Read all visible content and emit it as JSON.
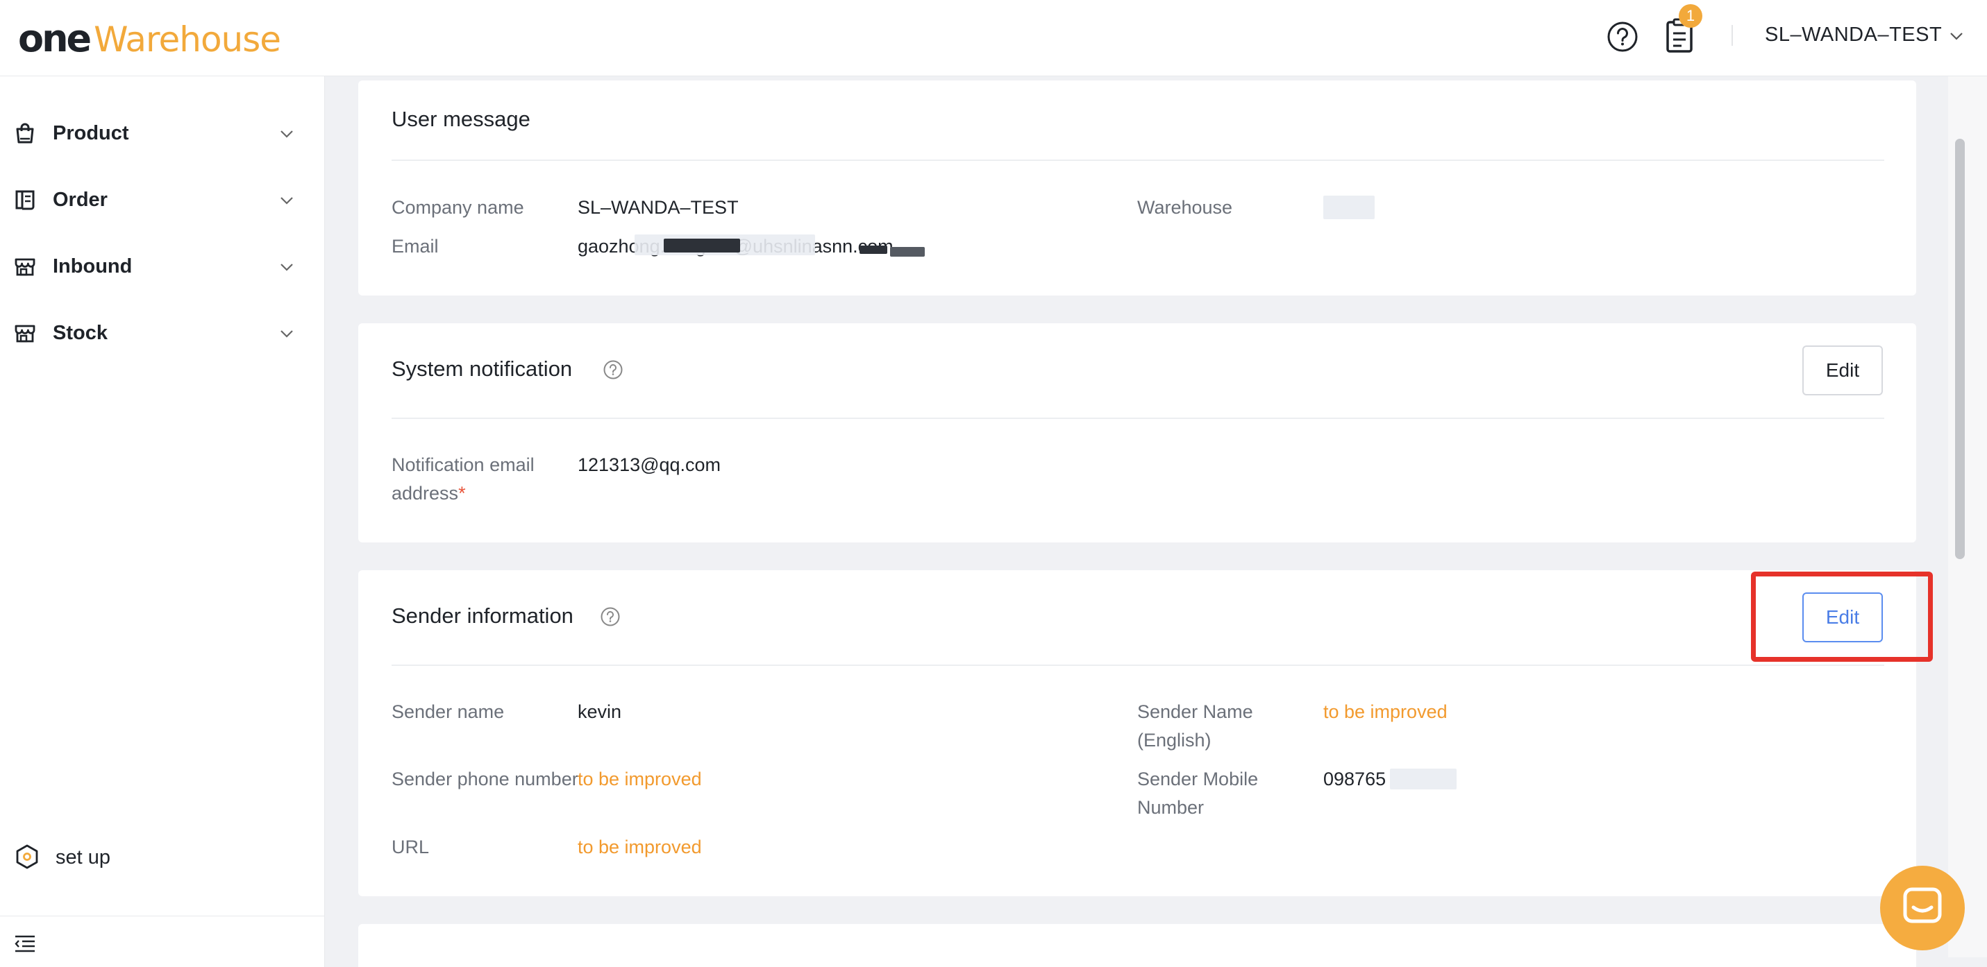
{
  "header": {
    "logo_one": "one",
    "logo_warehouse": "Warehouse",
    "notification_count": "1",
    "user_name": "SL–WANDA–TEST"
  },
  "sidebar": {
    "items": [
      {
        "label": "Product",
        "icon": "bag-icon"
      },
      {
        "label": "Order",
        "icon": "receipt-icon"
      },
      {
        "label": "Inbound",
        "icon": "store-icon"
      },
      {
        "label": "Stock",
        "icon": "store-icon"
      }
    ],
    "setup_label": "set up"
  },
  "user_message": {
    "title": "User message",
    "company_label": "Company name",
    "company_value": "SL–WANDA–TEST",
    "warehouse_label": "Warehouse",
    "email_label": "Email",
    "email_value_prefix": "gaozhong.ming",
    "email_value_suffix": "@uhsnlinasnn.com"
  },
  "system_notification": {
    "title": "System notification",
    "edit_label": "Edit",
    "notif_email_label": "Notification email address",
    "required_mark": "*",
    "notif_email_value": "121313@qq.com"
  },
  "sender_info": {
    "title": "Sender information",
    "edit_label": "Edit",
    "sender_name_label": "Sender name",
    "sender_name_value": "kevin",
    "sender_name_en_label": "Sender Name (English)",
    "sender_name_en_value": "to be improved",
    "sender_phone_label": "Sender phone number",
    "sender_phone_value": "to be improved",
    "sender_mobile_label": "Sender Mobile Number",
    "sender_mobile_value": "098765",
    "url_label": "URL",
    "url_value": "to be improved"
  },
  "colors": {
    "brand_orange": "#f2a93b",
    "warn_text": "#f29a2e",
    "primary_blue": "#4a7de6",
    "highlight_red": "#e6322a"
  }
}
